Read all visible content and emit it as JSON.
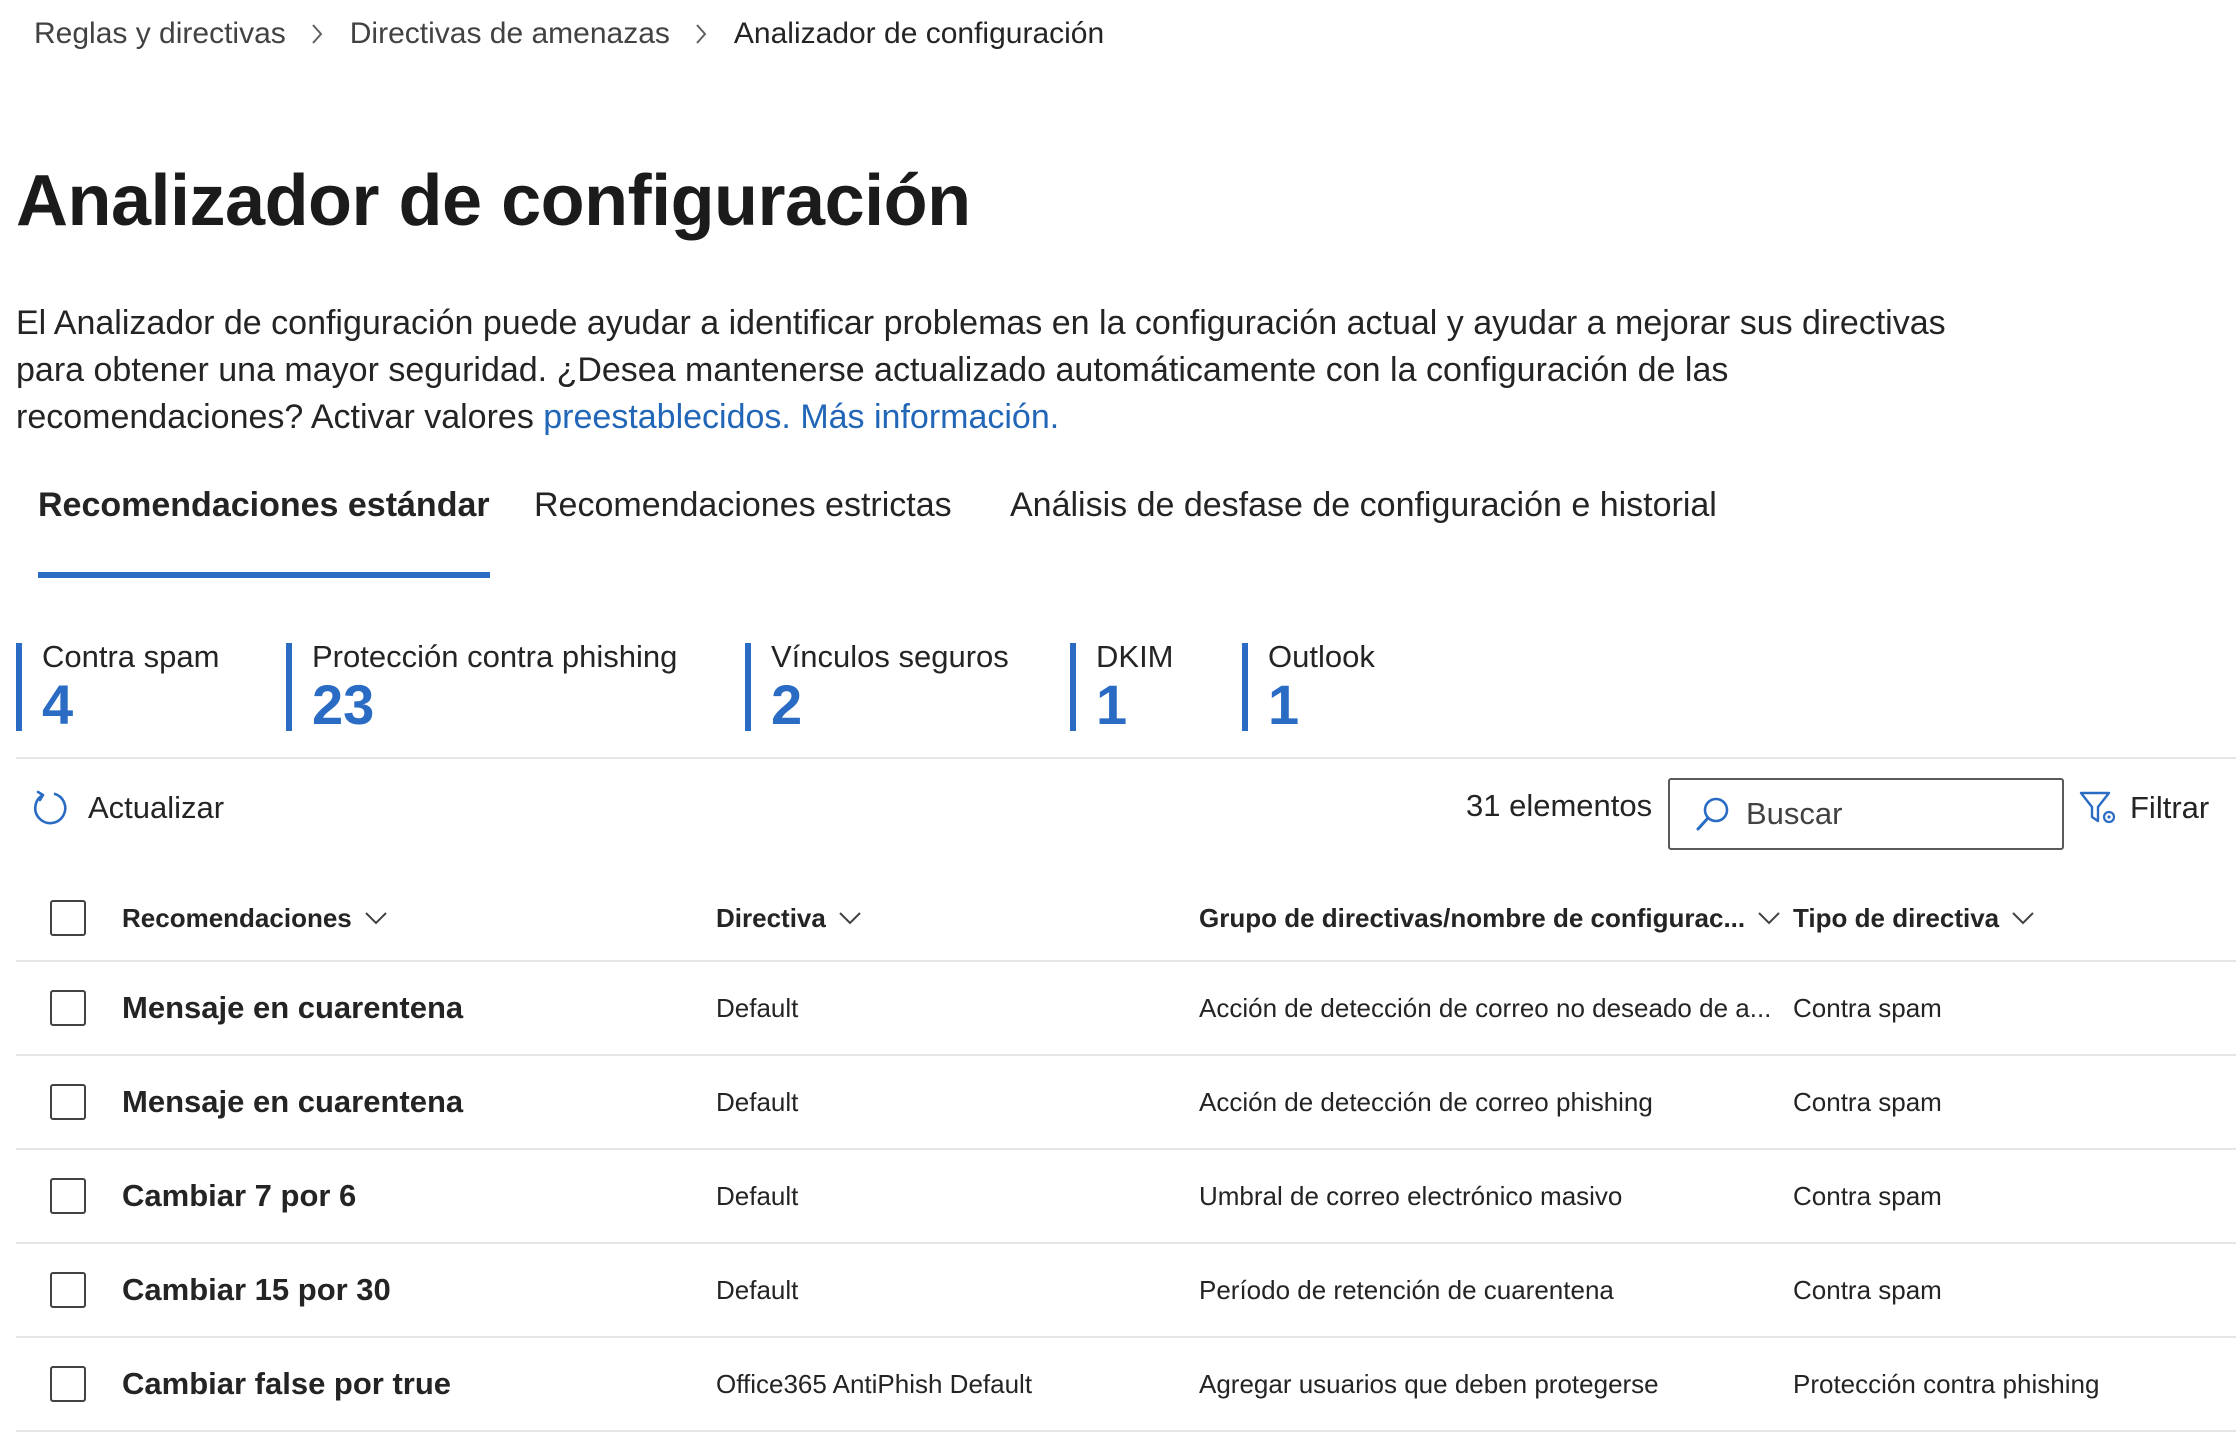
{
  "breadcrumb": [
    "Reglas y directivas",
    "Directivas de amenazas",
    "Analizador de configuración"
  ],
  "page_title": "Analizador de configuración",
  "description": {
    "text": "El Analizador de configuración puede ayudar a identificar problemas en la configuración actual y ayudar a mejorar sus directivas para obtener una mayor seguridad. ¿Desea mantenerse actualizado automáticamente con la configuración de las recomendaciones? Activar valores ",
    "link1": "preestablecidos.",
    "link2": "Más información."
  },
  "tabs": [
    {
      "label": "Recomendaciones estándar",
      "active": true
    },
    {
      "label": "Recomendaciones estrictas",
      "active": false
    },
    {
      "label": "Análisis de desfase de configuración e historial",
      "active": false
    }
  ],
  "stats": [
    {
      "label": "Contra spam",
      "value": "4"
    },
    {
      "label": "Protección contra phishing",
      "value": "23"
    },
    {
      "label": "Vínculos seguros",
      "value": "2"
    },
    {
      "label": "DKIM",
      "value": "1"
    },
    {
      "label": "Outlook",
      "value": "1"
    }
  ],
  "toolbar": {
    "refresh_label": "Actualizar",
    "item_count": "31 elementos",
    "search_placeholder": "Buscar",
    "filter_label": "Filtrar"
  },
  "table": {
    "columns": [
      "Recomendaciones",
      "Directiva",
      "Grupo de directivas/nombre de configurac...",
      "Tipo de directiva"
    ],
    "rows": [
      [
        "Mensaje en cuarentena",
        "Default",
        "Acción de detección de correo no deseado de a...",
        "Contra spam"
      ],
      [
        "Mensaje en cuarentena",
        "Default",
        "Acción de detección de correo phishing",
        "Contra spam"
      ],
      [
        "Cambiar 7 por 6",
        "Default",
        "Umbral de correo electrónico masivo",
        "Contra spam"
      ],
      [
        "Cambiar 15 por 30",
        "Default",
        "Período de retención de cuarentena",
        "Contra spam"
      ],
      [
        "Cambiar false por true",
        "Office365 AntiPhish Default",
        "Agregar usuarios que deben protegerse",
        "Protección contra phishing"
      ]
    ]
  },
  "colors": {
    "accent": "#2a6cc4",
    "link": "#2266b8",
    "text": "#242424"
  }
}
